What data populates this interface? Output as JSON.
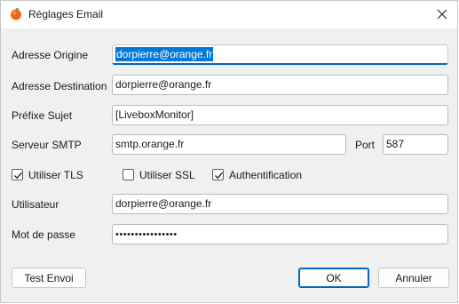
{
  "window": {
    "title": "Réglages Email"
  },
  "fields": {
    "origin": {
      "label": "Adresse Origine",
      "value": "dorpierre@orange.fr"
    },
    "destination": {
      "label": "Adresse Destination",
      "value": "dorpierre@orange.fr"
    },
    "subject_prefix": {
      "label": "Préfixe Sujet",
      "value": "[LiveboxMonitor]"
    },
    "smtp_server": {
      "label": "Serveur SMTP",
      "value": "smtp.orange.fr"
    },
    "port": {
      "label": "Port",
      "value": "587"
    },
    "user": {
      "label": "Utilisateur",
      "value": "dorpierre@orange.fr"
    },
    "password": {
      "label": "Mot de passe",
      "masked_value": "••••••••••••••••"
    }
  },
  "options": {
    "tls": {
      "label": "Utiliser TLS",
      "checked": true
    },
    "ssl": {
      "label": "Utiliser SSL",
      "checked": false
    },
    "auth": {
      "label": "Authentification",
      "checked": true
    }
  },
  "buttons": {
    "test": "Test Envoi",
    "ok": "OK",
    "cancel": "Annuler"
  },
  "colors": {
    "accent": "#0067c0",
    "selection": "#0078d7",
    "app_icon": "#ff6a00"
  },
  "icons": {
    "app": "orange-fruit-icon",
    "close": "close-icon",
    "check": "checkmark-icon"
  }
}
